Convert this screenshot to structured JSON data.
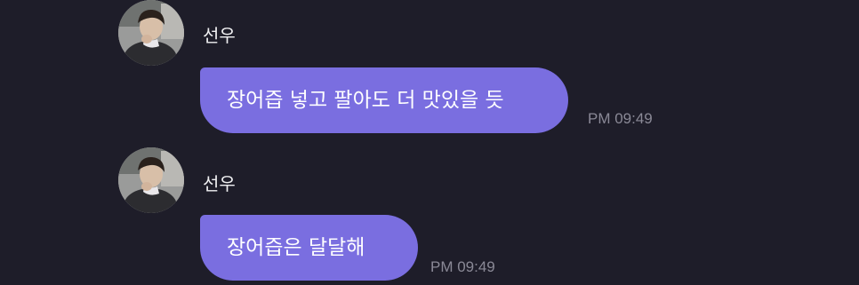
{
  "messages": [
    {
      "sender": "선우",
      "text": "장어즙 넣고 팔아도 더 맛있을 듯",
      "time": "PM 09:49"
    },
    {
      "sender": "선우",
      "text": "장어즙은 달달해",
      "time": "PM 09:49"
    }
  ],
  "colors": {
    "background": "#1e1d29",
    "bubble": "#7a6ee0",
    "bubble_text": "#ffffff",
    "name_text": "#f0f0f2",
    "time_text": "#8a8996"
  },
  "icons": {
    "avatar": "profile-photo"
  }
}
